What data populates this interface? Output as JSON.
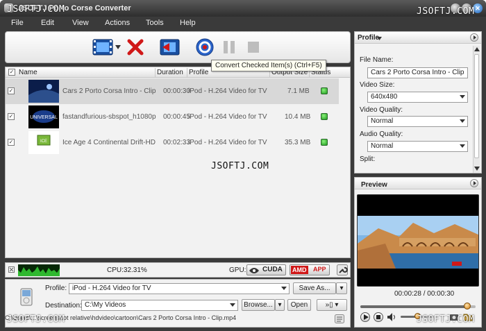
{
  "window": {
    "title": "JSOFTJ Porto Corse Converter"
  },
  "watermark": "JSOFTJ.COM",
  "menu": [
    "File",
    "Edit",
    "View",
    "Actions",
    "Tools",
    "Help"
  ],
  "toolbar": {
    "convert_tooltip": "Convert Checked Item(s) (Ctrl+F5)"
  },
  "list": {
    "headers": {
      "name": "Name",
      "duration": "Duration",
      "profile": "Profile",
      "output_size": "Output Size",
      "status": "Status"
    },
    "rows": [
      {
        "name": "Cars 2 Porto Corsa Intro - Clip",
        "duration": "00:00:30",
        "profile": "iPod - H.264 Video for TV",
        "size": "7.1 MB",
        "checked": true
      },
      {
        "name": "fastandfurious-sbspot_h1080p",
        "duration": "00:00:45",
        "profile": "iPod - H.264 Video for TV",
        "size": "10.4 MB",
        "checked": true
      },
      {
        "name": "Ice Age 4 Continental Drift-HD",
        "duration": "00:02:33",
        "profile": "iPod - H.264 Video for TV",
        "size": "35.3 MB",
        "checked": true
      }
    ],
    "thumb_text_2": "UNIVERSAL",
    "thumb_text_3": "ICE"
  },
  "info": {
    "cpu": "CPU:32.31%",
    "gpu_label": "GPU:",
    "cuda": "CUDA",
    "amd": "AMD",
    "app": "APP"
  },
  "bottom": {
    "profile_label": "Profile:",
    "profile_value": "iPod - H.264 Video for TV",
    "save_as": "Save As...",
    "destination_label": "Destination:",
    "destination_value": "C:\\My Videos",
    "browse": "Browse...",
    "open": "Open",
    "status_path": "C:\\Users\\...\\screenshot relative\\hdvideo\\cartoon\\Cars 2 Porto Corsa Intro - Clip.mp4"
  },
  "profile_panel": {
    "title": "Profile",
    "file_name_label": "File Name:",
    "file_name_value": "Cars 2 Porto Corsa Intro - Clip",
    "video_size_label": "Video Size:",
    "video_size_value": "640x480",
    "video_quality_label": "Video Quality:",
    "video_quality_value": "Normal",
    "audio_quality_label": "Audio Quality:",
    "audio_quality_value": "Normal",
    "split_label": "Split:"
  },
  "preview": {
    "title": "Preview",
    "time": "00:00:28 / 00:00:30",
    "progress": 0.93,
    "volume": 0.5
  },
  "colors": {
    "accent_green": "#2fb82f",
    "amd_red": "#d01818"
  }
}
